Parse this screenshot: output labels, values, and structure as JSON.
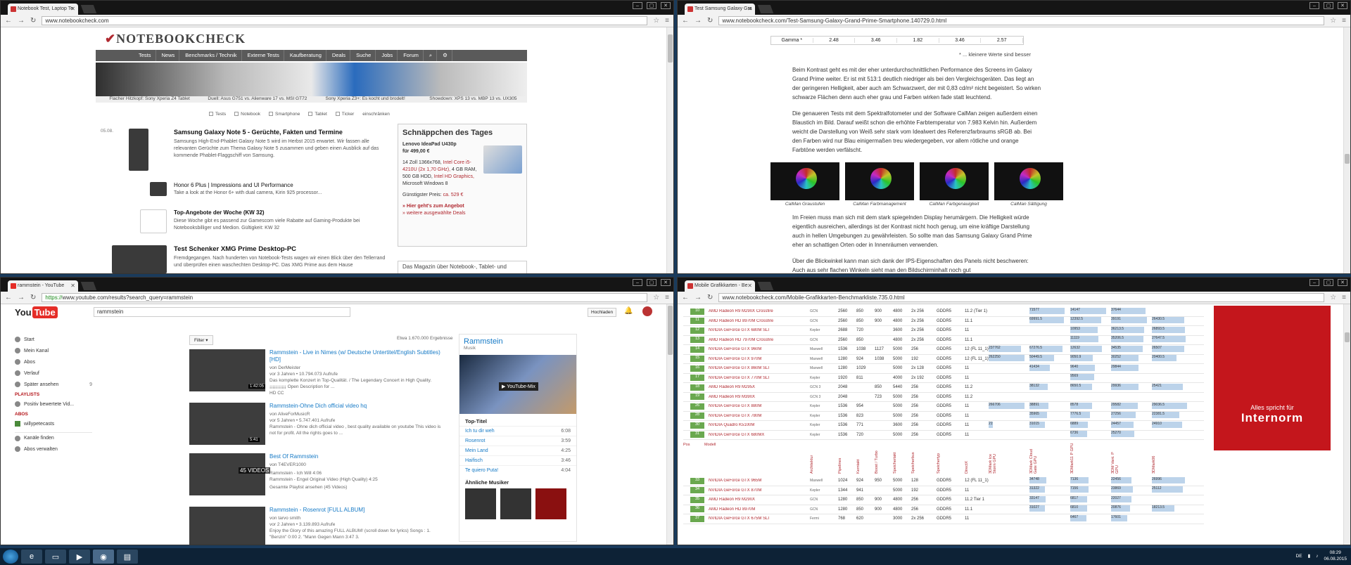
{
  "win1": {
    "tab_title": "Notebook Test, Laptop Te",
    "url": "www.notebookcheck.com",
    "logo": "NOTEBOOKCHECK",
    "menu": [
      "Tests",
      "News",
      "Benchmarks / Technik",
      "Externe Tests",
      "Kaufberatung",
      "Deals",
      "Suche",
      "Jobs",
      "Forum"
    ],
    "banner_captions": [
      "Flacher Hitzkopf: Sony Xperia Z4 Tablet",
      "Duell: Asus G751 vs. Alienware 17 vs. MSI GT72",
      "Sony Xperia Z3+: Es kocht und brodelt!",
      "Showdown: XPS 13 vs. MBP 13 vs. UX305"
    ],
    "filters": [
      "Tests",
      "Notebook",
      "Smartphone",
      "Tablet",
      "Ticker",
      "einschränken"
    ],
    "news": [
      {
        "date": "05.08.",
        "title": "Samsung Galaxy Note 5 - Gerüchte, Fakten und Termine",
        "text": "Samsungs High-End-Phablet Galaxy Note 5 wird im Herbst 2015 erwartet. Wir fassen alle relevanten Gerüchte zum Thema Galaxy Note 5 zusammen und geben einen Ausblick auf das kommende Phablet-Flaggschiff von Samsung."
      },
      {
        "date": "",
        "title": "Honor 6 Plus | Impressions and UI Performance",
        "text": "Take a look at the Honor 6+ with dual camera, Kirin 925 processor..."
      },
      {
        "date": "",
        "title": "Top-Angebote der Woche (KW 32)",
        "text": "Diese Woche gibt es passend zur Gamescom viele Rabatte auf Gaming-Produkte bei Notebooksbilliger und Medion. Gültigkeit: KW 32"
      },
      {
        "date": "",
        "title": "Test Schenker XMG Prime Desktop-PC",
        "text": "Fremdgegangen. Nach hunderten von Notebook-Tests wagen wir einen Blick über den Tellerrand und überprüfen einen waschechten Desktop-PC. Das XMG Prime aus dem Hause"
      }
    ],
    "deal": {
      "title": "Schnäppchen des Tages",
      "product": "Lenovo IdeaPad U430p",
      "price": "für 499,00 €",
      "spec1": "14 Zoll 1366x768,",
      "spec2": "Intel Core i5-4210U (2x 1,70 GHz),",
      "spec3": "4 GB RAM, 500 GB HDD,",
      "spec4": "Intel HD Graphics,",
      "spec5": "Microsoft Windows 8",
      "cheapest_label": "Günstigster Preis:",
      "cheapest": "ca. 529 €",
      "link1": "» Hier geht's zum Angebot",
      "link2": "» weitere ausgewählte Deals",
      "footer": "Das Magazin über Notebook-, Tablet- und"
    }
  },
  "win2": {
    "tab_title": "Test Samsung Galaxy Gra",
    "url": "www.notebookcheck.com/Test-Samsung-Galaxy-Grand-Prime-Smartphone.140729.0.html",
    "gamma": [
      "Gamma *",
      "2.48",
      "3.46",
      "1.82",
      "3.46",
      "2.57"
    ],
    "smaller_note": "* ... kleinere Werte sind besser",
    "para1": "Beim Kontrast geht es mit der eher unterdurchschnittlichen Performance des Screens im Galaxy Grand Prime weiter. Er ist mit 513:1 deutlich niedriger als bei den Vergleichsgeräten. Das liegt an der geringeren Helligkeit, aber auch am Schwarzwert, der mit 0,83 cd/m² nicht begeistert. So wirken schwarze Flächen denn auch eher grau und Farben wirken fade statt leuchtend.",
    "para2": "Die genaueren Tests mit dem Spektralfotometer und der Software CalMan zeigen außerdem einen Blaustich im Bild. Darauf weißt schon die erhöhte Farbtemperatur von 7.983 Kelvin hin. Außerdem weicht die Darstellung von Weiß sehr stark vom Idealwert des Referenzfarbraums sRGB ab. Bei den Farben wird nur Blau einigermaßen treu wiedergegeben, vor allem rötliche und orange Farbtöne werden verfälscht.",
    "captions": [
      "CalMan Graustufen",
      "CalMan Farbmanagement",
      "CalMan Farbgenauigkeit",
      "CalMan Sättigung"
    ],
    "para3": "Im Freien muss man sich mit dem stark spiegelnden Display herumärgern. Die Helligkeit würde eigentlich ausreichen, allerdings ist der Kontrast nicht hoch genug, um eine kräftige Darstellung auch in hellen Umgebungen zu gewährleisten. So sollte man das Samsung Galaxy Grand Prime eher an schattigen Orten oder in Innenräumen verwenden.",
    "para4": "Über die Blickwinkel kann man sich dank der IPS-Eigenschaften des Panels nicht beschweren: Auch aus sehr flachen Winkeln sieht man den Bildschirminhalt noch gut"
  },
  "win3": {
    "tab_title": "rammstein - YouTube",
    "url_secure": "https://",
    "url": "www.youtube.com/results?search_query=rammstein",
    "search": "rammstein",
    "upload": "Hochladen",
    "side": [
      {
        "label": "Start",
        "icon": "home-icon"
      },
      {
        "label": "Mein Kanal",
        "icon": "user-icon"
      },
      {
        "label": "Abos",
        "icon": "subscriptions-icon"
      },
      {
        "label": "Verlauf",
        "icon": "history-icon"
      },
      {
        "label": "Später ansehen",
        "icon": "watch-later-icon"
      }
    ],
    "watch_later_count": "9",
    "playlists_hdr": "PLAYLISTS",
    "playlist": "Positiv bewertete Vid...",
    "abos_hdr": "ABOS",
    "abo": "willypetecasts",
    "channels_find": "Kanäle finden",
    "manage_abos": "Abos verwalten",
    "filter": "Filter",
    "results": "Etwa 1.670.000 Ergebnisse",
    "videos": [
      {
        "title": "Rammstein - Live in Nimes (w/ Deutsche Untertitel/English Subtitles) [HD]",
        "meta": "von DerMeister",
        "meta2": "vor 3 Jahren • 10.794.073 Aufrufe",
        "desc": "Das komplette Konzert in Top-Qualität. / The Legendary Concert in High Quality. ¡¡¡¡¡¡¡¡¡¡¡ Open Description for ...",
        "badges": "HD   CC",
        "dur": "1:42:05"
      },
      {
        "title": "Rammstein-Ohne Dich official video hq",
        "meta": "von AliveForMusicR",
        "meta2": "vor 5 Jahren • 5.747.401 Aufrufe",
        "desc": "Rammstein - Ohne dich official video , best quality available on youtube This video is not for profit. All the rights goes to ...",
        "badges": "",
        "dur": "5:41"
      },
      {
        "title": "Best Of Rammstein",
        "meta": "von T4EVER1000",
        "meta2": "Rammstein - Ich Will   4:06",
        "desc": "Rammstein - Engel Original Video (High Quality)   4:25",
        "badges": "Gesamte Playlist ansehen (45 Videos)",
        "dur": "45 VIDEOS"
      },
      {
        "title": "Rammstein - Rosenrot [FULL ALBUM]",
        "meta": "von tarvo smith",
        "meta2": "vor 2 Jahren • 3.139.893 Aufrufe",
        "desc": "Enjoy the Glory of this amazing FULL ALBUM! (scroll down for lyrics) Songs : 1. \"Benzin\" 0:00 2. \"Mann Gegen Mann 3:47 3.",
        "badges": "",
        "dur": "45:57"
      }
    ],
    "card": {
      "title": "Rammstein",
      "sub": "Musik",
      "mix": "YouTube-Mix",
      "top": "Top-Titel",
      "tracks": [
        [
          "Ich tu dir weh",
          "6:08"
        ],
        [
          "Rosenrot",
          "3:59"
        ],
        [
          "Mein Land",
          "4:25"
        ],
        [
          "Haifisch",
          "3:46"
        ],
        [
          "Te quiero Puta!",
          "4:04"
        ]
      ],
      "similar": "Ähnliche Musiker"
    }
  },
  "win4": {
    "tab_title": "Mobile Grafikkarten - Be",
    "url": "www.notebookcheck.com/Mobile-Grafikkarten-Benchmarkliste.735.0.html",
    "rows": [
      {
        "pos": "10",
        "name": "AMD Radeon R9 M290X Crossfire",
        "arch": "GCN",
        "a": "2560",
        "b": "850",
        "c": "900",
        "d": "4800",
        "e": "2x 256",
        "f": "GDDR5",
        "g": "11.2 (Tier 1)",
        "s1": "",
        "s2": "71577",
        "s3": "14147",
        "s4": "37644",
        "s5": ""
      },
      {
        "pos": "11",
        "name": "AMD Radeon HD 8970M Crossfire",
        "arch": "GCN",
        "a": "2560",
        "b": "850",
        "c": "900",
        "d": "4800",
        "e": "2x 256",
        "f": "GDDR5",
        "g": "11.1",
        "s1": "",
        "s2": "69991.5",
        "s3": "12392.5",
        "s4": "39191",
        "s5": "26430.5"
      },
      {
        "pos": "12",
        "name": "NVIDIA GeForce GTX 680M SLI",
        "arch": "Kepler",
        "a": "2688",
        "b": "720",
        "c": "",
        "d": "3600",
        "e": "2x 256",
        "f": "GDDR5",
        "g": "11",
        "s1": "",
        "s2": "",
        "s3": "10953",
        "s4": "36213.5",
        "s5": "26893.5"
      },
      {
        "pos": "13",
        "name": "AMD Radeon HD 7970M Crossfire",
        "arch": "GCN",
        "a": "2560",
        "b": "850",
        "c": "",
        "d": "4800",
        "e": "2x 256",
        "f": "GDDR5",
        "g": "11.1",
        "s1": "",
        "s2": "",
        "s3": "11119",
        "s4": "35206.5",
        "s5": "27647.5"
      },
      {
        "pos": "14",
        "name": "NVIDIA GeForce GTX 960M",
        "arch": "Maxwell",
        "a": "1536",
        "b": "1038",
        "c": "1127",
        "d": "5000",
        "e": "256",
        "f": "GDDR5",
        "g": "12 (FL 11_1)",
        "s1": "237762",
        "s2": "67276.5",
        "s3": "12632",
        "s4": "34535",
        "s5": "26507"
      },
      {
        "pos": "15",
        "name": "NVIDIA GeForce GTX 970M",
        "arch": "Maxwell",
        "a": "1280",
        "b": "924",
        "c": "1038",
        "d": "5000",
        "e": "192",
        "f": "GDDR5",
        "g": "12 (FL 11_1)",
        "s1": "262250",
        "s2": "50449.5",
        "s3": "9050.9",
        "s4": "30252",
        "s5": "20400.5"
      },
      {
        "pos": "16",
        "name": "NVIDIA GeForce GTX 860M SLI",
        "arch": "Maxwell",
        "a": "1280",
        "b": "1029",
        "c": "",
        "d": "5000",
        "e": "2x 128",
        "f": "GDDR5",
        "g": "11",
        "s1": "",
        "s2": "41434",
        "s3": "9640",
        "s4": "29844",
        "s5": ""
      },
      {
        "pos": "17",
        "name": "NVIDIA GeForce GTX 770M SLI",
        "arch": "Kepler",
        "a": "1920",
        "b": "811",
        "c": "",
        "d": "4000",
        "e": "2x 192",
        "f": "GDDR5",
        "g": "11",
        "s1": "",
        "s2": "",
        "s3": "9569",
        "s4": "",
        "s5": ""
      },
      {
        "pos": "18",
        "name": "AMD Radeon R9 M295X",
        "arch": "GCN 3",
        "a": "2048",
        "b": "",
        "c": "850",
        "d": "5440",
        "e": "256",
        "f": "GDDR5",
        "g": "11.2",
        "s1": "",
        "s2": "38132",
        "s3": "8650.5",
        "s4": "29936",
        "s5": "25421"
      },
      {
        "pos": "19",
        "name": "AMD Radeon R9 M390X",
        "arch": "GCN 3",
        "a": "2048",
        "b": "",
        "c": "723",
        "d": "5000",
        "e": "256",
        "f": "GDDR5",
        "g": "11.2",
        "s1": "",
        "s2": "",
        "s3": "",
        "s4": "",
        "s5": ""
      },
      {
        "pos": "26",
        "name": "NVIDIA GeForce GTX 880M",
        "arch": "Kepler",
        "a": "1536",
        "b": "954",
        "c": "",
        "d": "5000",
        "e": "256",
        "f": "GDDR5",
        "g": "11",
        "s1": "266706",
        "s2": "38891",
        "s3": "8578",
        "s4": "29582",
        "s5": "29036.5"
      },
      {
        "pos": "28",
        "name": "NVIDIA GeForce GTX 780M",
        "arch": "Kepler",
        "a": "1536",
        "b": "823",
        "c": "",
        "d": "5000",
        "e": "256",
        "f": "GDDR5",
        "g": "11",
        "s1": "",
        "s2": "35965",
        "s3": "7776.5",
        "s4": "27256",
        "s5": "22381.5"
      },
      {
        "pos": "30",
        "name": "NVIDIA Quadro K5100M",
        "arch": "Kepler",
        "a": "1536",
        "b": "771",
        "c": "",
        "d": "3600",
        "e": "256",
        "f": "GDDR5",
        "g": "11",
        "s1": "2197",
        "s2": "31015",
        "s3": "6889",
        "s4": "24457",
        "s5": "24910"
      },
      {
        "pos": "31",
        "name": "NVIDIA GeForce GTX 680MX",
        "arch": "Kepler",
        "a": "1536",
        "b": "720",
        "c": "",
        "d": "5000",
        "e": "256",
        "f": "GDDR5",
        "g": "11",
        "s1": "",
        "s2": "",
        "s3": "6736",
        "s4": "25270",
        "s5": ""
      }
    ],
    "headers": [
      "Pos",
      "Modell",
      "Architektur",
      "Pipelines",
      "Kerntakt",
      "Boost / Turbo",
      "Speichertakt",
      "Speicherbus",
      "Speichertyp",
      "DirectX",
      "3DMark Ice Storm GPU",
      "3DMark Cloud Gate GPU",
      "3DMark11 P GPU",
      "3DM Vant. P GPU",
      "3DMark06"
    ],
    "rows2": [
      {
        "pos": "33",
        "name": "NVIDIA GeForce GTX 965M",
        "arch": "Maxwell",
        "a": "1024",
        "b": "924",
        "c": "950",
        "d": "5000",
        "e": "128",
        "f": "GDDR5",
        "g": "12 (FL 11_1)",
        "s1": "",
        "s2": "34748",
        "s3": "7136",
        "s4": "22456",
        "s5": "26996"
      },
      {
        "pos": "34",
        "name": "NVIDIA GeForce GTX 870M",
        "arch": "Kepler",
        "a": "1344",
        "b": "941",
        "c": "",
        "d": "5000",
        "e": "192",
        "f": "GDDR5",
        "g": "11",
        "s1": "",
        "s2": "31322",
        "s3": "7156",
        "s4": "23869",
        "s5": "25112"
      },
      {
        "pos": "35",
        "name": "AMD Radeon R9 M290X",
        "arch": "GCN",
        "a": "1280",
        "b": "850",
        "c": "900",
        "d": "4800",
        "e": "256",
        "f": "GDDR5",
        "g": "11.2 Tier 1",
        "s1": "",
        "s2": "33147",
        "s3": "6817",
        "s4": "22027",
        "s5": ""
      },
      {
        "pos": "36",
        "name": "AMD Radeon HD 8970M",
        "arch": "GCN",
        "a": "1280",
        "b": "850",
        "c": "900",
        "d": "4800",
        "e": "256",
        "f": "GDDR5",
        "g": "11.1",
        "s1": "",
        "s2": "31027",
        "s3": "6810",
        "s4": "20876",
        "s5": "18213.5"
      },
      {
        "pos": "37",
        "name": "NVIDIA GeForce GTX 675M SLI",
        "arch": "Fermi",
        "a": "768",
        "b": "620",
        "c": "",
        "d": "3000",
        "e": "2x 256",
        "f": "GDDR5",
        "g": "11",
        "s1": "",
        "s2": "",
        "s3": "6467",
        "s4": "17601",
        "s5": ""
      }
    ],
    "ad_line1": "Alles spricht für",
    "ad_line2": "Internorm"
  },
  "taskbar": {
    "lang": "DE",
    "time": "08:29",
    "date": "06.08.2015"
  },
  "colors": {
    "nbc_red": "#b0282f",
    "yt_red": "#e52d27",
    "bar": "#bcd3ea",
    "pos_green": "#6aa84f"
  }
}
